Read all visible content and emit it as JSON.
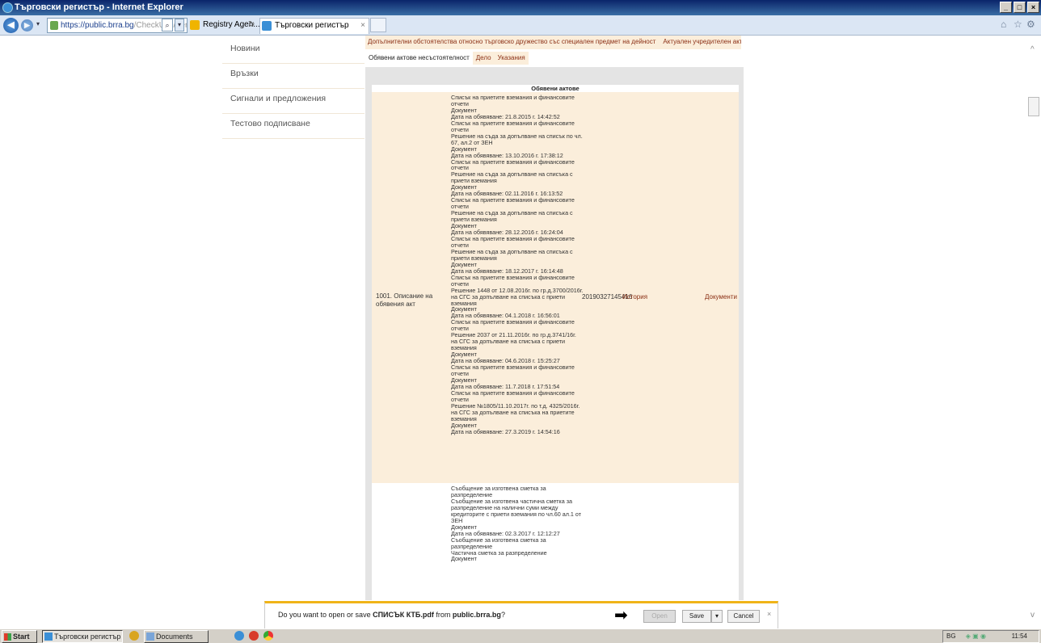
{
  "window": {
    "title": "Търговски регистър - Internet Explorer",
    "controls": [
      "_",
      "□",
      "×"
    ]
  },
  "browser": {
    "address_host": "https://public.brra.bg",
    "address_path": "/CheckUps/Verificati",
    "tab_registry": "Registry Agen...",
    "tab_active": "Търговски регистър",
    "tab_close": "×"
  },
  "sidebar": {
    "items": [
      {
        "label": "Новини"
      },
      {
        "label": "Връзки"
      },
      {
        "label": "Сигнали и предложения"
      },
      {
        "label": "Тестово подписване"
      }
    ]
  },
  "content": {
    "top_links": [
      "Допълнителни обстоятелства относно търговско дружество със специален предмет на дейност",
      "Актуален учредителен акт"
    ],
    "subtabs": {
      "active": "Обявени актове несъстоятелност",
      "others": [
        "Дело",
        "Указания"
      ]
    },
    "table_header": "Обявени актове",
    "row1": {
      "label": "1001. Описание на обявения акт",
      "number": "20190327145416",
      "history": "История",
      "documents": "Документи"
    },
    "row1_entries": [
      "Списък на приетите вземания и финансовите",
      "отчети",
      "Документ",
      "Дата на обявяване: 21.8.2015 г. 14:42:52",
      "Списък на приетите вземания и финансовите",
      "отчети",
      "Решение на съда за допълване на списък по чл.",
      "67, ал.2 от ЗЕН",
      "Документ",
      "Дата на обявяване: 13.10.2016 г. 17:38:12",
      "Списък на приетите вземания и финансовите",
      "отчети",
      "Решение на съда за допълване на списъка с",
      "приети вземания",
      "Документ",
      "Дата на обявяване: 02.11.2016 г. 16:13:52",
      "Списък на приетите вземания и финансовите",
      "отчети",
      "Решение на съда за допълване на списъка с",
      "приети вземания",
      "Документ",
      "Дата на обявяване: 28.12.2016 г. 16:24:04",
      "Списък на приетите вземания и финансовите",
      "отчети",
      "Решение на съда за допълване на списъка с",
      "приети вземания",
      "Документ",
      "Дата на обявяване: 18.12.2017 г. 16:14:48",
      "Списък на приетите вземания и финансовите",
      "отчети",
      "Решение 1448 от 12.08.2016г. по гр.д.3700/2016г.",
      "на СГС за допълване на списъка с приети",
      "вземания",
      "Документ",
      "Дата на обявяване: 04.1.2018 г. 16:56:01",
      "Списък на приетите вземания и финансовите",
      "отчети",
      "Решение 2037 от 21.11.2016г. по гр.д.3741/16г.",
      "на СГС за допълване на списъка с приети",
      "вземания",
      "Документ",
      "Дата на обявяване: 04.6.2018 г. 15:25:27",
      "Списък на приетите вземания и финансовите",
      "отчети",
      "Документ",
      "Дата на обявяване: 11.7.2018 г. 17:51:54",
      "Списък на приетите вземания и финансовите",
      "отчети",
      "Решение №1805/11.10.2017г. по т.д. 4325/2016г.",
      "на СГС за допълване на списъка на приетите",
      "вземания",
      "Документ",
      "Дата на обявяване: 27.3.2019 г. 14:54:16"
    ],
    "row2_entries": [
      "Съобщение за изготвена сметка за",
      "разпределение",
      "Съобщение за изготвена частична сметка за",
      "разпределение на налични суми между",
      "кредиторите с приети вземания по чл.60 ал.1 от",
      "ЗЕН",
      "Документ",
      "Дата на обявяване: 02.3.2017 г. 12:12:27",
      "Съобщение за изготвена сметка за",
      "разпределение",
      "Частична сметка за разпределение",
      "Документ"
    ]
  },
  "download_bar": {
    "prefix": "Do you want to open or save ",
    "filename": "СПИСЪК КТБ.pdf",
    "middle": " from ",
    "source": "public.brra.bg",
    "suffix": "?",
    "open_label": "Open",
    "save_label": "Save",
    "save_arrow": "▾",
    "cancel_label": "Cancel",
    "close": "×"
  },
  "taskbar": {
    "start_label": "Start",
    "tasks": [
      "Търговски регистър -...",
      "Documents"
    ],
    "tray_lang": "BG",
    "clock": "11:54"
  },
  "colors": {
    "accent_bar": "#f0b418",
    "row_highlight": "#fbeedb",
    "link": "#8b2f14"
  }
}
